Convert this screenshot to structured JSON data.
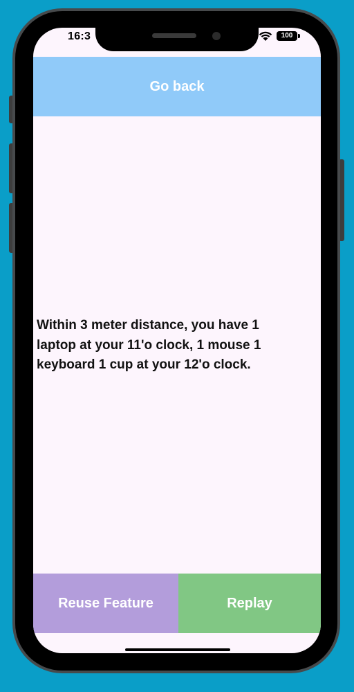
{
  "status_bar": {
    "time": "16:3",
    "battery": "100",
    "wifi_icon": "wifi-icon",
    "battery_icon": "battery-icon"
  },
  "header": {
    "go_back_label": "Go back"
  },
  "main": {
    "description": "Within 3 meter distance, you have 1 laptop at your 11'o clock, 1 mouse 1 keyboard 1 cup at your 12'o clock."
  },
  "footer": {
    "reuse_label": "Reuse Feature",
    "replay_label": "Replay"
  },
  "colors": {
    "background": "#0a9ec8",
    "screen": "#fdf5fd",
    "go_back": "#90caf9",
    "reuse": "#b39ddb",
    "replay": "#81c784"
  }
}
